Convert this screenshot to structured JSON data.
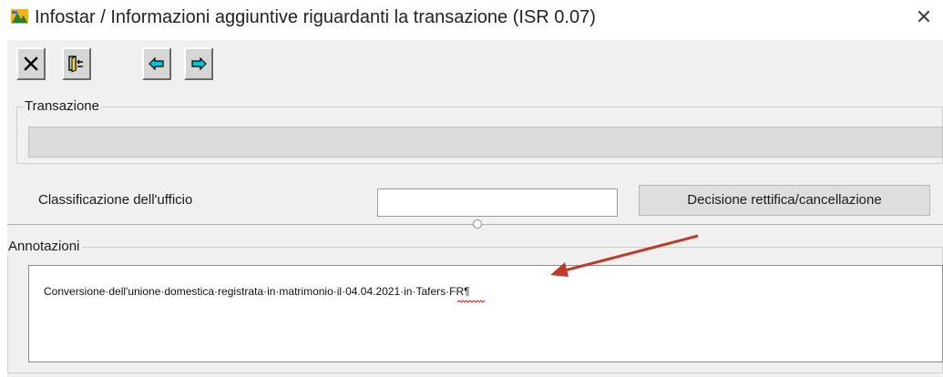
{
  "window": {
    "title": "Infostar / Informazioni aggiuntive riguardanti la transazione (ISR 0.07)",
    "close_glyph": "✕"
  },
  "toolbar": {
    "buttons": [
      {
        "name": "close-record-button",
        "icon": "x-icon"
      },
      {
        "name": "exit-door-button",
        "icon": "door-exit-icon"
      },
      {
        "name": "previous-button",
        "icon": "arrow-left-icon"
      },
      {
        "name": "next-button",
        "icon": "arrow-right-icon"
      }
    ]
  },
  "transaction": {
    "legend": "Transazione",
    "value": ""
  },
  "classification": {
    "label": "Classificazione dell'ufficio",
    "value": "",
    "decision_button": "Decisione rettifica/cancellazione"
  },
  "notes": {
    "legend": "Annotazioni",
    "text": "Conversione·dell'unione·domestica·registrata·in·matrimonio·il·04.04.2021·in·Tafers·FR¶"
  },
  "colors": {
    "window_bg": "#f0f0f0",
    "button_bg": "#d6d6d6",
    "arrow_icon": "#00c8d8",
    "annotation_arrow": "#c0392b",
    "spellcheck_underline": "#e02020"
  }
}
